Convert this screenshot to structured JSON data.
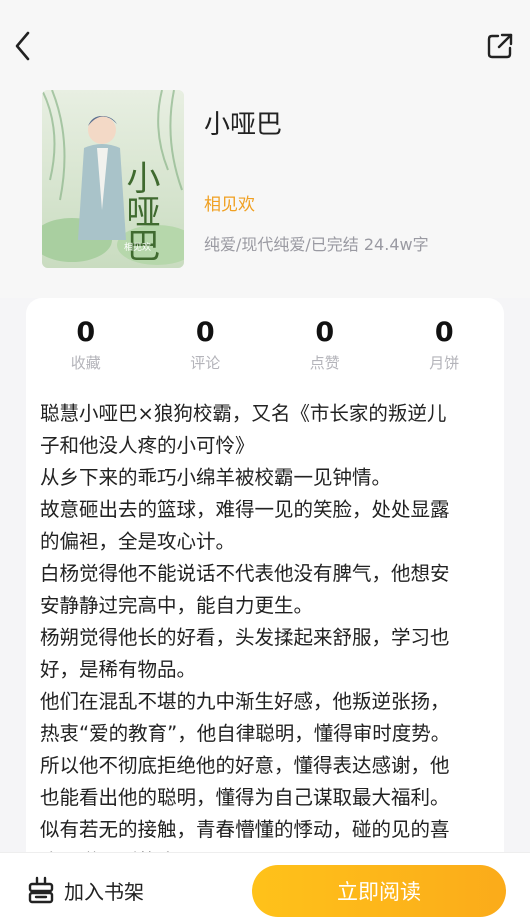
{
  "book": {
    "title": "小哑巴",
    "author": "相见欢",
    "meta": "纯爱/现代纯爱/已完结 24.4w字",
    "cover_title_text": "小哑巴",
    "cover_author_text": "相见欢"
  },
  "stats": [
    {
      "value": "0",
      "label": "收藏"
    },
    {
      "value": "0",
      "label": "评论"
    },
    {
      "value": "0",
      "label": "点赞"
    },
    {
      "value": "0",
      "label": "月饼"
    }
  ],
  "description_lines": [
    "聪慧小哑巴×狼狗校霸，又名《市长家的叛逆儿",
    "子和他没人疼的小可怜》",
    "从乡下来的乖巧小绵羊被校霸一见钟情。",
    "故意砸出去的篮球，难得一见的笑脸，处处显露",
    "的偏袒，全是攻心计。",
    "白杨觉得他不能说话不代表他没有脾气，他想安",
    "安静静过完高中，能自力更生。",
    "杨朔觉得他长的好看，头发揉起来舒服，学习也",
    "好，是稀有物品。",
    "他们在混乱不堪的九中渐生好感，他叛逆张扬，",
    "热衷“爱的教育”，他自律聪明，懂得审时度势。",
    "所以他不彻底拒绝他的好意，懂得表达感谢，他",
    "也能看出他的聪明，懂得为自己谋取最大福利。",
    "似有若无的接触，青春懵懂的悸动，碰的见的喜",
    "欢，碰不到的疼"
  ],
  "bottom": {
    "add_shelf_label": "加入书架",
    "read_now_label": "立即阅读"
  },
  "icons": {
    "back": "chevron-left-icon",
    "share": "share-icon",
    "shelf": "bookshelf-icon"
  },
  "colors": {
    "author": "#f0a022",
    "button": "#fbb41a"
  }
}
